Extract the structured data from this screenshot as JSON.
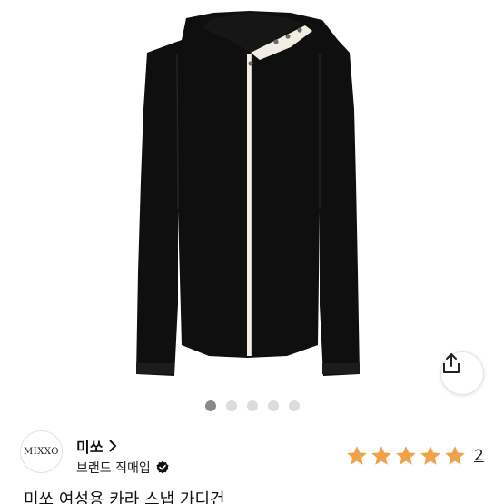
{
  "product": {
    "title": "미쏘 여성용 카라 스냅 가디건"
  },
  "gallery": {
    "image_count": 5,
    "active_index": 0,
    "colors": {
      "garment": "#0f0f0f",
      "placket": "#f2ede2",
      "snap": "#6d6a63"
    }
  },
  "share": {
    "icon": "share-icon"
  },
  "brand": {
    "logo_text": "MIXXO",
    "name": "미쏘",
    "badge_label": "브랜드 직매입",
    "badge_icon": "verified-check-icon"
  },
  "rating": {
    "stars": 5,
    "max_stars": 5,
    "review_count": "2",
    "color": "#f0a24a"
  }
}
